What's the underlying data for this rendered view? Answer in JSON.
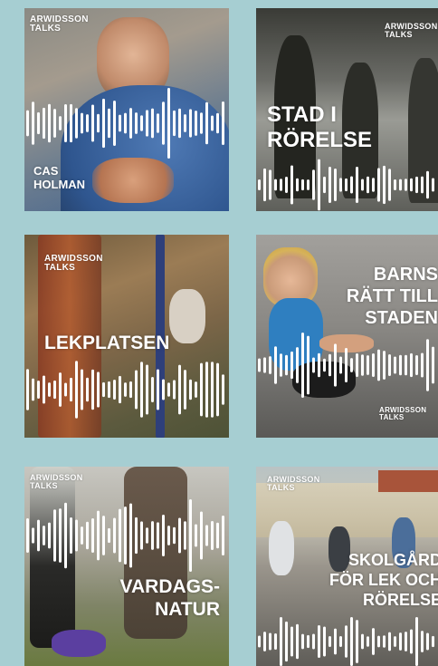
{
  "background_color": "#a6ced2",
  "brand": {
    "line1": "ARWIDSSON",
    "line2": "TALKS"
  },
  "episodes": [
    {
      "title_lines": [
        "CAS",
        "HOLMAN"
      ]
    },
    {
      "title_lines": [
        "STAD I",
        "RÖRELSE"
      ]
    },
    {
      "title_lines": [
        "LEKPLATSEN"
      ]
    },
    {
      "title_lines": [
        "BARNS",
        "RÄTT TILL",
        "STADEN"
      ]
    },
    {
      "title_lines": [
        "VARDAGS-",
        "NATUR"
      ]
    },
    {
      "title_lines": [
        "SKOLGÅRD",
        "FÖR LEK OCH",
        "RÖRELSE"
      ]
    }
  ]
}
